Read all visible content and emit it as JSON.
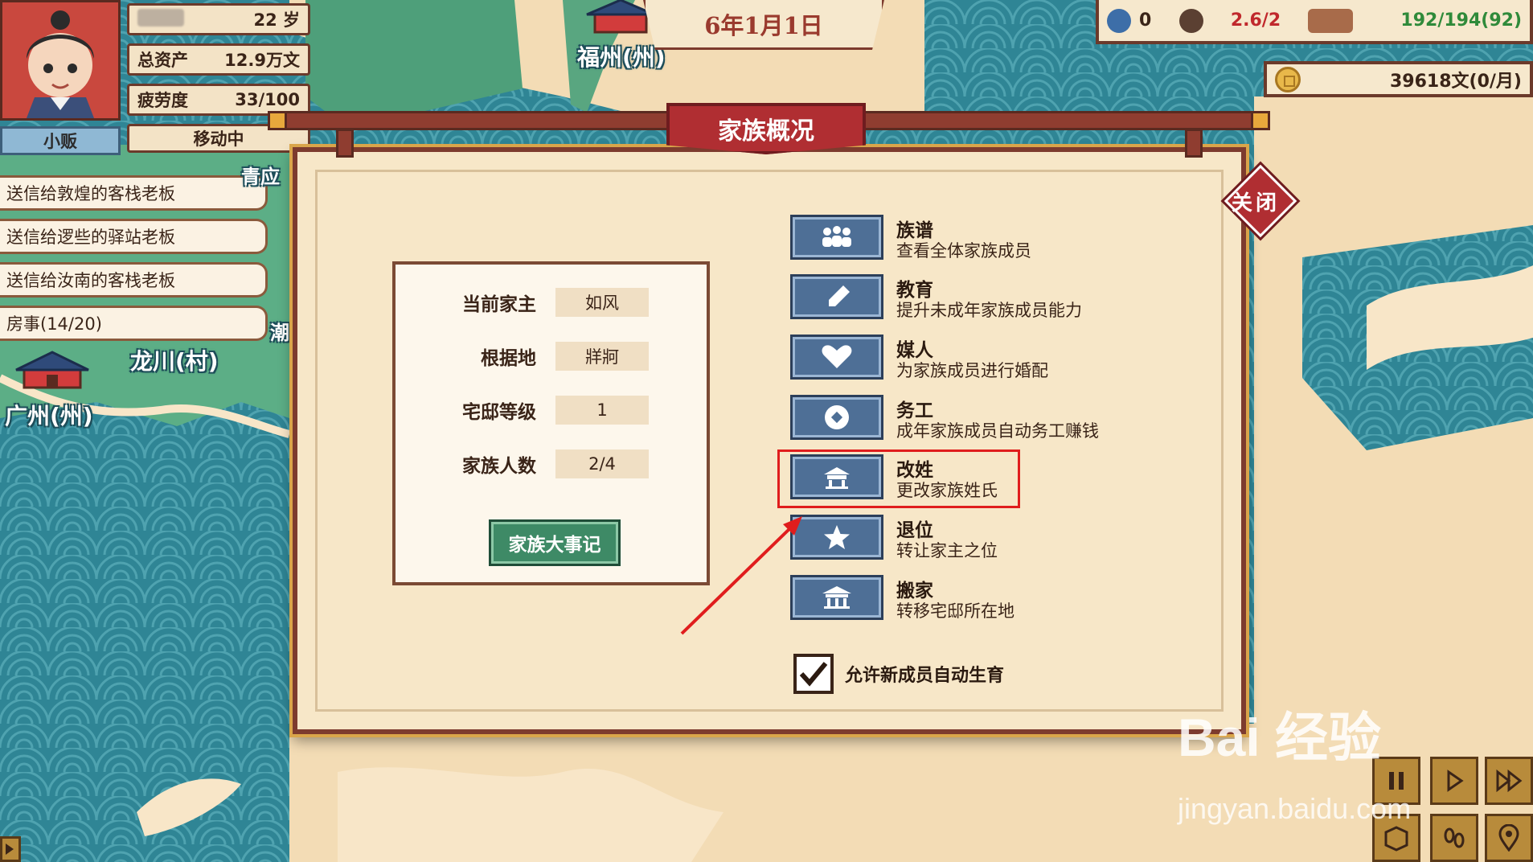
{
  "player": {
    "age": "22 岁",
    "assets_label": "总资产",
    "assets_value": "12.9万文",
    "fatigue_label": "疲劳度",
    "fatigue_value": "33/100",
    "role": "小贩",
    "status": "移动中"
  },
  "tasks": [
    "送信给敦煌的客栈老板",
    "送信给逻些的驿站老板",
    "送信给汝南的客栈老板",
    "房事(14/20)"
  ],
  "map_labels": {
    "fuzhou": "福州(州)",
    "longchuan": "龙川(村)",
    "guangzhou": "广州(州)",
    "partial_top": "青应",
    "partial_mid": "潮"
  },
  "date": "6年1月1日",
  "resources": {
    "a_value": "0",
    "b_value": "2.6/2",
    "c_value": "192/194(92)",
    "money": "39618文(0/月)"
  },
  "colors": {
    "accent_red": "#b02e32",
    "panel_bg": "#f7e7c8",
    "action_blue": "#4e6f96",
    "green_button": "#3e8a66",
    "highlight": "#e01d1d",
    "resource_red": "#c0282c",
    "resource_green": "#2f8a3a"
  },
  "dialog": {
    "title": "家族概况",
    "close_label": "关闭",
    "info": [
      {
        "key": "当前家主",
        "value": "如风"
      },
      {
        "key": "根据地",
        "value": "牂牁"
      },
      {
        "key": "宅邸等级",
        "value": "1"
      },
      {
        "key": "家族人数",
        "value": "2/4"
      }
    ],
    "events_button": "家族大事记",
    "actions": [
      {
        "title": "族谱",
        "desc": "查看全体家族成员",
        "icon": "family-icon"
      },
      {
        "title": "教育",
        "desc": "提升未成年家族成员能力",
        "icon": "brush-icon"
      },
      {
        "title": "媒人",
        "desc": "为家族成员进行婚配",
        "icon": "heart-icon"
      },
      {
        "title": "务工",
        "desc": "成年家族成员自动务工赚钱",
        "icon": "coin-icon"
      },
      {
        "title": "改姓",
        "desc": "更改家族姓氏",
        "icon": "house-icon"
      },
      {
        "title": "退位",
        "desc": "转让家主之位",
        "icon": "star-icon"
      },
      {
        "title": "搬家",
        "desc": "转移宅邸所在地",
        "icon": "building-icon"
      }
    ],
    "auto_birth_label": "允许新成员自动生育",
    "auto_birth_checked": true
  },
  "watermark": {
    "main": "Bai  经验",
    "sub": "jingyan.baidu.com"
  }
}
